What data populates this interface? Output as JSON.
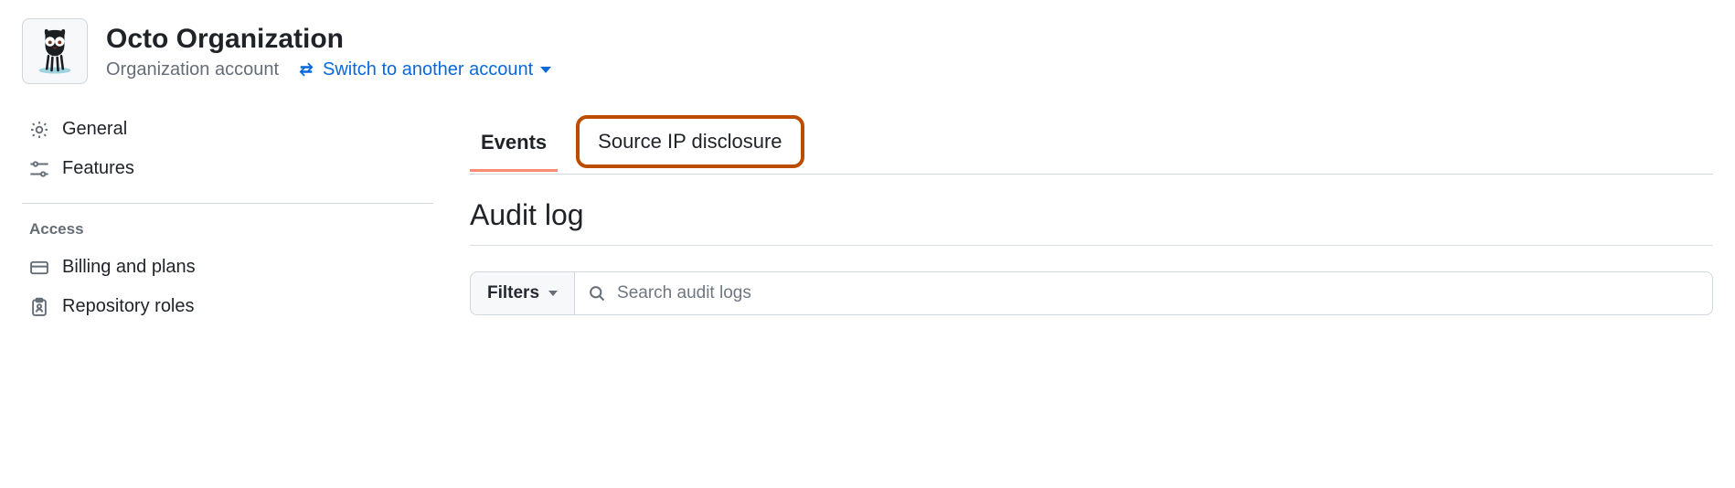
{
  "header": {
    "org_name": "Octo Organization",
    "sub_label": "Organization account",
    "switch_label": "Switch to another account"
  },
  "sidebar": {
    "items": [
      {
        "icon": "gear-icon",
        "label": "General"
      },
      {
        "icon": "sliders-icon",
        "label": "Features"
      }
    ],
    "section_title": "Access",
    "access_items": [
      {
        "icon": "credit-card-icon",
        "label": "Billing and plans"
      },
      {
        "icon": "clipboard-person-icon",
        "label": "Repository roles"
      }
    ]
  },
  "main": {
    "tabs": [
      {
        "label": "Events",
        "active": true
      },
      {
        "label": "Source IP disclosure",
        "highlighted": true
      }
    ],
    "page_title": "Audit log",
    "filters_label": "Filters",
    "search_placeholder": "Search audit logs"
  }
}
